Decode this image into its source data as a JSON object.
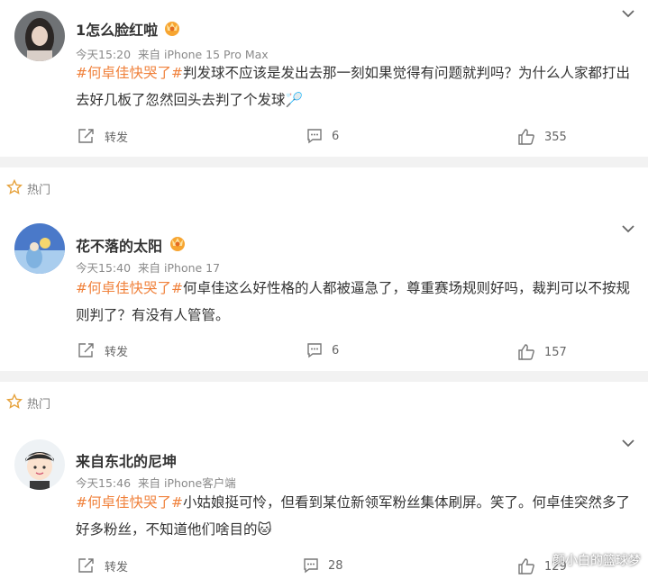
{
  "posts": [
    {
      "username": "1怎么脸红啦",
      "time": "今天15:20",
      "source": "来自 iPhone 15 Pro Max",
      "tag": "#何卓佳快哭了#",
      "text": "判发球不应该是发出去那一刻如果觉得有问题就判吗？为什么人家都打出去好几板了忽然回头去判了个发球",
      "emoji": "🏸",
      "repost_label": "转发",
      "comments": "6",
      "likes": "355"
    },
    {
      "username": "花不落的太阳",
      "time": "今天15:40",
      "source": "来自 iPhone 17",
      "tag": "#何卓佳快哭了#",
      "text": "何卓佳这么好性格的人都被逼急了，尊重赛场规则好吗，裁判可以不按规则判了？有没有人管管。",
      "emoji": "",
      "repost_label": "转发",
      "comments": "6",
      "likes": "157"
    },
    {
      "username": "来自东北的尼坤",
      "time": "今天15:46",
      "source": "来自 iPhone客户端",
      "tag": "#何卓佳快哭了#",
      "text": "小姑娘挺可怜，但看到某位新领军粉丝集体刷屏。笑了。何卓佳突然多了好多粉丝，不知道他们啥目的",
      "emoji": "🐱",
      "repost_label": "转发",
      "comments": "28",
      "likes": "129"
    }
  ],
  "hot_label": "热门",
  "watermark": "颜小白的篮球梦",
  "colors": {
    "tag": "#f0813b",
    "meta": "#8a8a8a",
    "separator": "#f2f2f2"
  }
}
